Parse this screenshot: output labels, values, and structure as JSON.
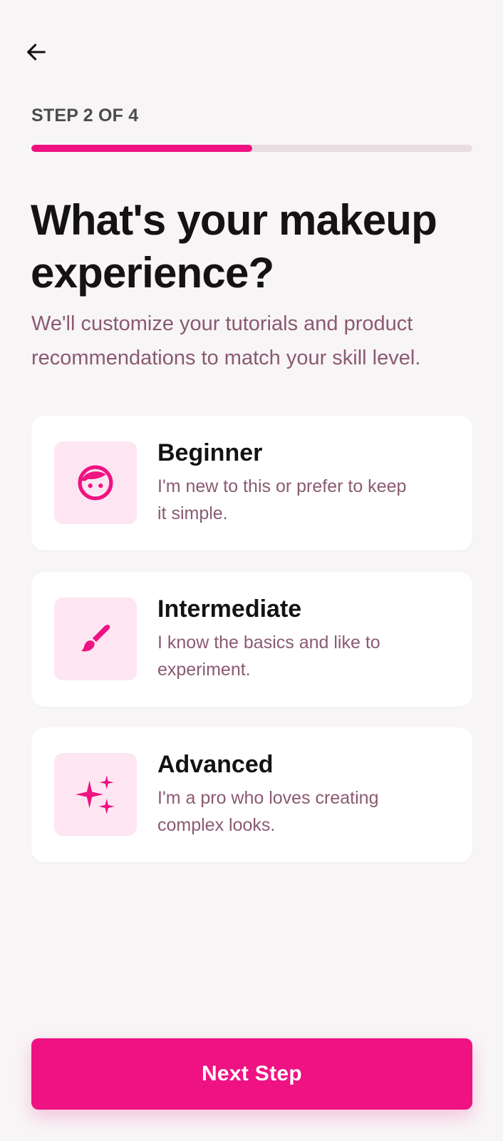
{
  "header": {
    "back_icon": "arrow-left-icon",
    "step_label": "STEP 2 OF 4",
    "progress_fraction": 0.5
  },
  "main": {
    "title": "What's your makeup experience?",
    "subtitle": "We'll customize your tutorials and product recommendations to match your skill level."
  },
  "options": [
    {
      "icon": "face-icon",
      "title": "Beginner",
      "description": "I'm new to this or prefer to keep it simple."
    },
    {
      "icon": "brush-icon",
      "title": "Intermediate",
      "description": "I know the basics and like to experiment."
    },
    {
      "icon": "sparkles-icon",
      "title": "Advanced",
      "description": "I'm a pro who loves creating complex looks."
    }
  ],
  "footer": {
    "next_label": "Next Step"
  },
  "colors": {
    "accent": "#ef1283",
    "icon_bg": "#fde6f1",
    "muted_text": "#8a5a71",
    "background": "#f8f5f6"
  }
}
